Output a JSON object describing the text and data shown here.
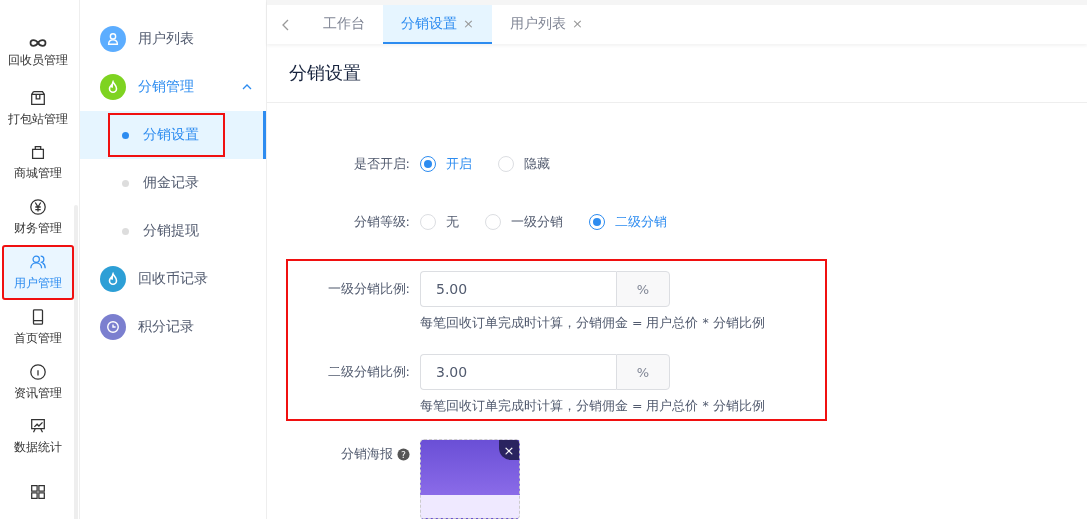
{
  "rail": [
    {
      "label": "回收员管理",
      "selected": false,
      "highlighted": false
    },
    {
      "label": "打包站管理",
      "selected": false,
      "highlighted": false
    },
    {
      "label": "商城管理",
      "selected": false,
      "highlighted": false
    },
    {
      "label": "财务管理",
      "selected": false,
      "highlighted": false
    },
    {
      "label": "用户管理",
      "selected": true,
      "highlighted": true
    },
    {
      "label": "首页管理",
      "selected": false,
      "highlighted": false
    },
    {
      "label": "资讯管理",
      "selected": false,
      "highlighted": false
    },
    {
      "label": "数据统计",
      "selected": false,
      "highlighted": false
    },
    {
      "selected": false,
      "highlighted": false
    }
  ],
  "sidebar": {
    "items": [
      {
        "label": "用户列表",
        "color": "#5cadff",
        "selected": false,
        "expanded": false
      },
      {
        "label": "分销管理",
        "color": "#7ed321",
        "selected": false,
        "expanded": true,
        "children": [
          {
            "label": "分销设置",
            "selected": true,
            "highlighted": true
          },
          {
            "label": "佣金记录",
            "selected": false,
            "highlighted": false
          },
          {
            "label": "分销提现",
            "selected": false,
            "highlighted": false
          }
        ]
      },
      {
        "label": "回收币记录",
        "color": "#2d9fd6",
        "selected": false,
        "expanded": false
      },
      {
        "label": "积分记录",
        "color": "#7b7fcf",
        "selected": false,
        "expanded": false
      }
    ]
  },
  "tabs": [
    {
      "label": "工作台",
      "selected": false
    },
    {
      "label": "分销设置",
      "close": "×",
      "selected": true
    },
    {
      "label": "用户列表",
      "close": "×",
      "selected": false
    }
  ],
  "page_title": "分销设置",
  "form": [
    {
      "kind": "radio",
      "label": "是否开启:",
      "options": [
        {
          "label": "开启",
          "selected": true
        },
        {
          "label": "隐藏",
          "selected": false
        }
      ]
    },
    {
      "kind": "radio",
      "label": "分销等级:",
      "options": [
        {
          "label": "无",
          "selected": false
        },
        {
          "label": "一级分销",
          "selected": false
        },
        {
          "label": "二级分销",
          "selected": true
        }
      ]
    },
    {
      "kind": "group",
      "highlighted": true,
      "fields": [
        {
          "label": "一级分销比例:",
          "value": "5.00",
          "suffix": "%",
          "hint": "每笔回收订单完成时计算，分销佣金 = 用户总价 * 分销比例"
        },
        {
          "label": "二级分销比例:",
          "value": "3.00",
          "suffix": "%",
          "hint": "每笔回收订单完成时计算，分销佣金 = 用户总价 * 分销比例"
        }
      ]
    },
    {
      "kind": "poster",
      "label": "分销海报",
      "help": "?",
      "close": "×"
    }
  ]
}
